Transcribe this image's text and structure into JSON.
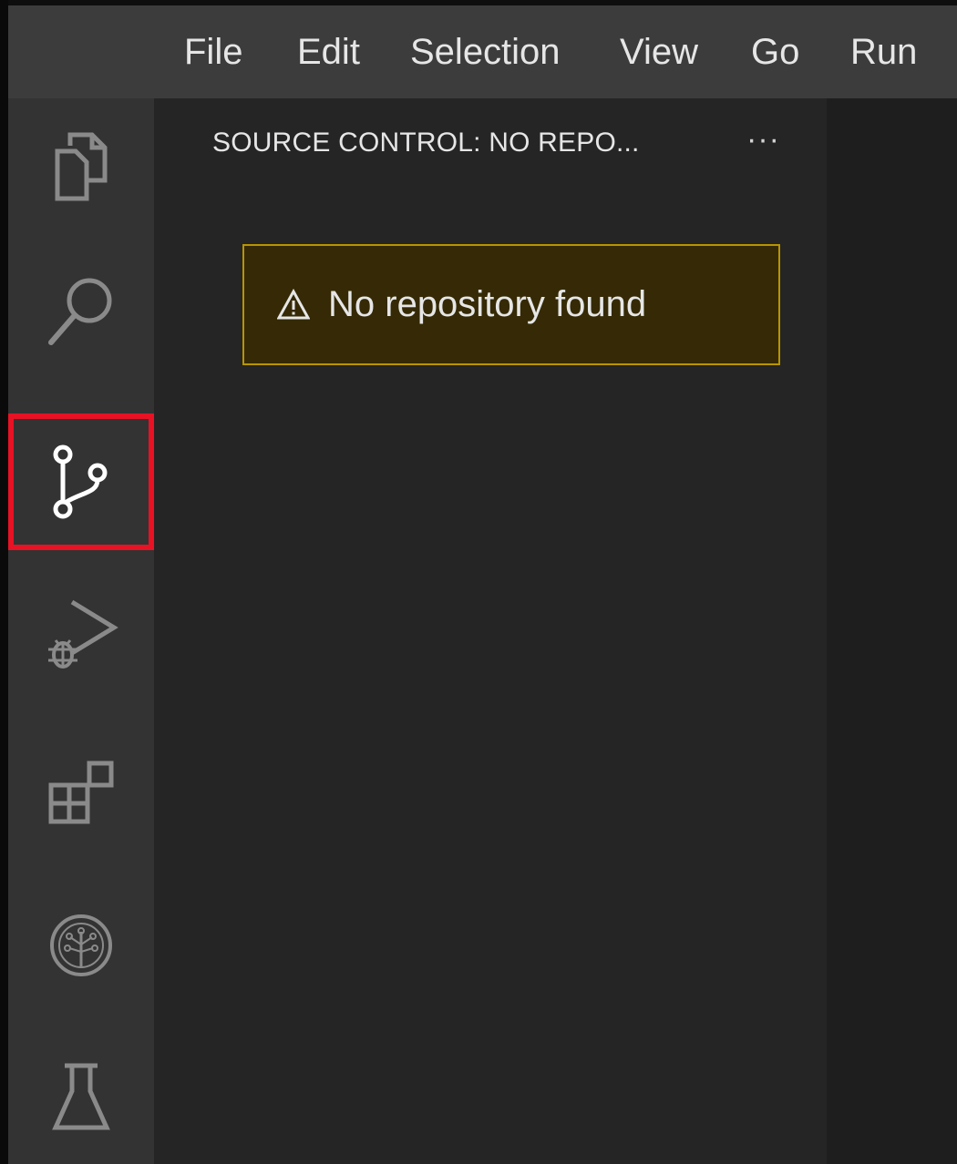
{
  "menubar": {
    "items": [
      "File",
      "Edit",
      "Selection",
      "View",
      "Go",
      "Run"
    ]
  },
  "activitybar": {
    "icons": [
      {
        "name": "explorer-icon",
        "active": false
      },
      {
        "name": "search-icon",
        "active": false
      },
      {
        "name": "source-control-icon",
        "active": true
      },
      {
        "name": "run-debug-icon",
        "active": false
      },
      {
        "name": "extensions-icon",
        "active": false
      },
      {
        "name": "tree-extension-icon",
        "active": false
      },
      {
        "name": "testing-icon",
        "active": false
      }
    ],
    "highlight_color": "#e81224"
  },
  "sidebar": {
    "title": "SOURCE CONTROL: NO REPO...",
    "more_label": "···",
    "warning": {
      "icon": "warning-icon",
      "text": "No repository found"
    }
  },
  "colors": {
    "menubar_bg": "#3c3c3c",
    "activitybar_bg": "#333333",
    "sidebar_bg": "#252526",
    "editor_bg": "#1e1e1e",
    "warning_bg": "#352a05",
    "warning_border": "#b89500"
  }
}
